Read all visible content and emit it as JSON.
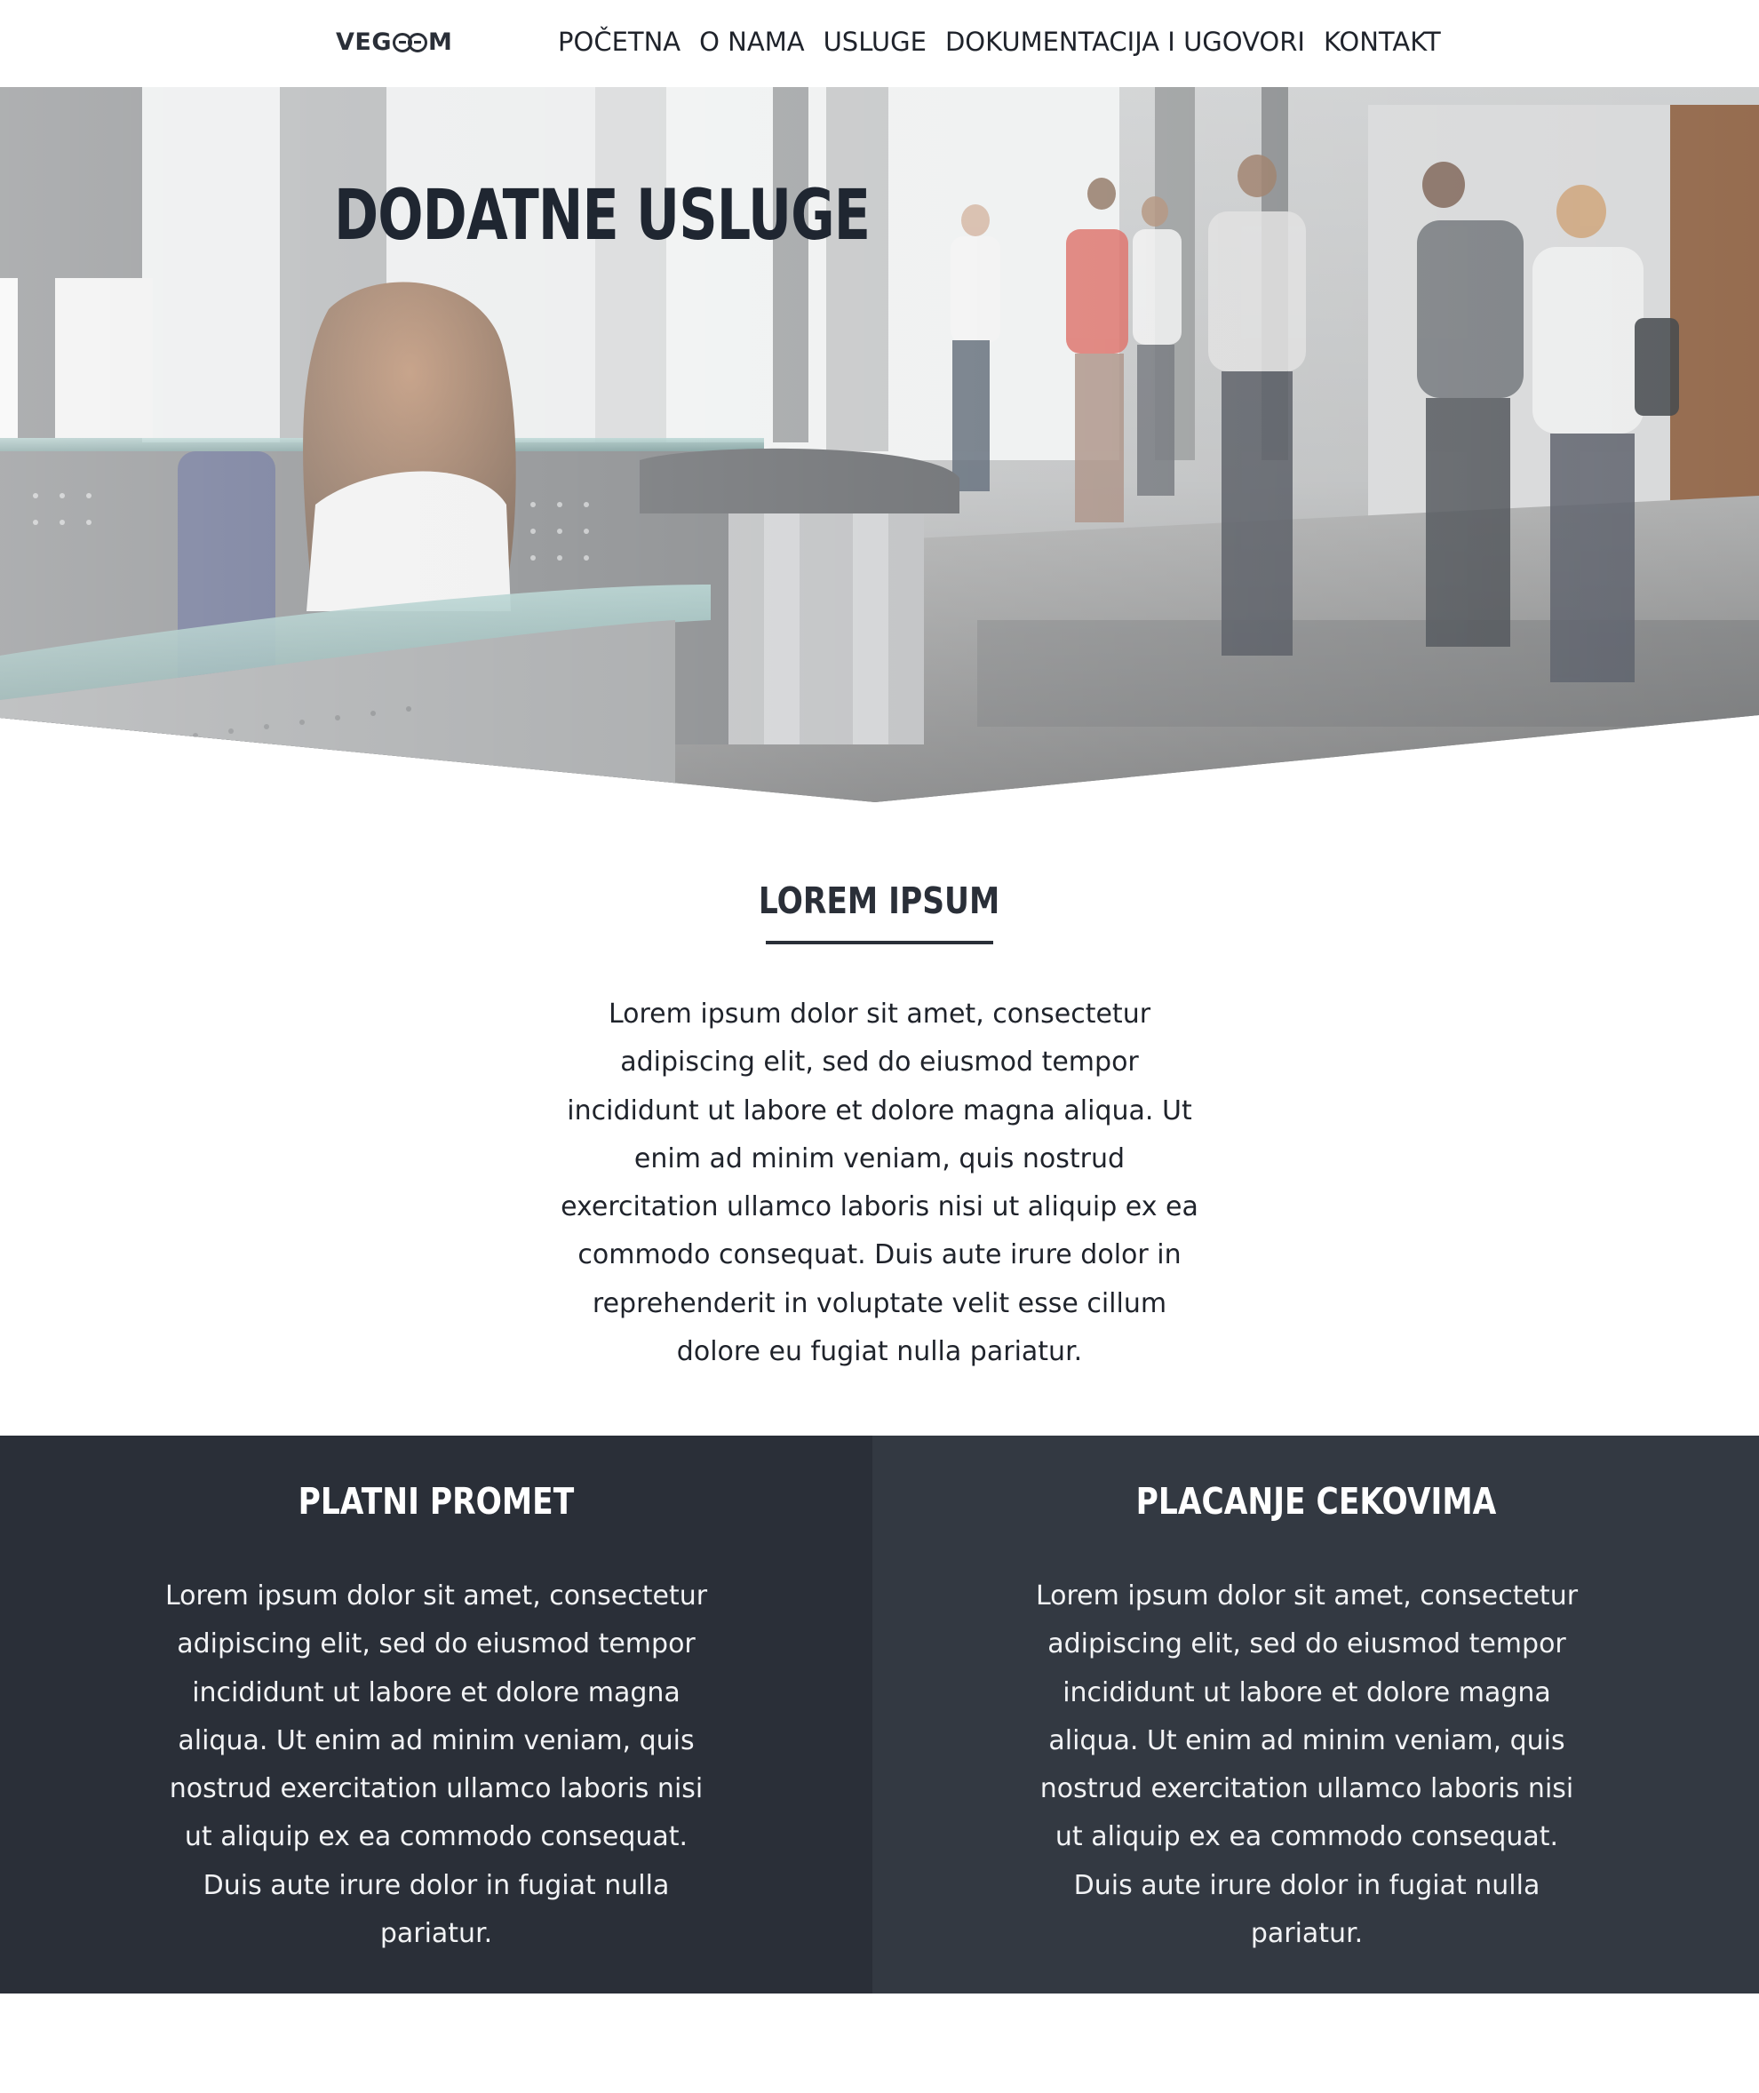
{
  "header": {
    "logo": {
      "before": "VEG",
      "after": "M"
    },
    "nav": [
      "POČETNA",
      "O NAMA",
      "USLUGE",
      "DOKUMENTACIJA I UGOVORI",
      "KONTAKT"
    ]
  },
  "hero": {
    "title": "DODATNE USLUGE",
    "image": "office-reception-photo"
  },
  "intro": {
    "heading": "LOREM IPSUM",
    "text": "Lorem ipsum dolor sit amet, consectetur adipiscing elit, sed do eiusmod tempor incididunt ut labore et dolore magna aliqua. Ut enim ad minim veniam, quis nostrud exercitation ullamco laboris nisi ut aliquip ex ea commodo consequat. Duis aute irure dolor in reprehenderit in voluptate velit esse cillum dolore eu fugiat nulla pariatur."
  },
  "columns": [
    {
      "heading": "PLATNI PROMET",
      "text": "Lorem ipsum dolor sit amet, consectetur adipiscing elit, sed do eiusmod tempor incididunt ut labore et dolore magna aliqua. Ut enim ad minim veniam, quis nostrud exercitation ullamco laboris nisi ut aliquip ex ea commodo consequat. Duis aute irure dolor in fugiat nulla pariatur."
    },
    {
      "heading": "PLACANJE CEKOVIMA",
      "text": "Lorem ipsum dolor sit amet, consectetur adipiscing elit, sed do eiusmod tempor incididunt ut labore et dolore magna aliqua. Ut enim ad minim veniam, quis nostrud exercitation ullamco laboris nisi ut aliquip ex ea commodo consequat. Duis aute irure dolor in fugiat nulla pariatur."
    }
  ],
  "colors": {
    "dark": "#2a2f38",
    "dark_alt": "#333942",
    "heading": "#1f2631",
    "background": "#ffffff"
  }
}
